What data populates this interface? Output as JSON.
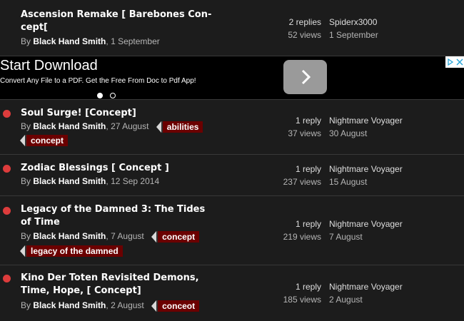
{
  "threads": [
    {
      "title": "Ascension Remake [ Barebones Con- cept[",
      "by": "By",
      "author": "Black Hand Smith",
      "date": "1 September",
      "tags": [],
      "replies": "2 replies",
      "views": "52 views",
      "last_user": "Spiderx3000",
      "last_date": "1 September",
      "unread": false
    },
    {
      "title": "Soul Surge! [Concept]",
      "by": "By",
      "author": "Black Hand Smith",
      "date": "27 August",
      "tags": [
        "abilities",
        "concept"
      ],
      "replies": "1 reply",
      "views": "37 views",
      "last_user": "Nightmare Voyager",
      "last_date": "30 August",
      "unread": true
    },
    {
      "title": "Zodiac Blessings [ Concept ]",
      "by": "By",
      "author": "Black Hand Smith",
      "date": "12 Sep 2014",
      "tags": [],
      "replies": "1 reply",
      "views": "237 views",
      "last_user": "Nightmare Voyager",
      "last_date": "15 August",
      "unread": true
    },
    {
      "title": "Legacy of the Damned 3: The Tides of Time",
      "by": "By",
      "author": "Black Hand Smith",
      "date": "7 August",
      "tags": [
        "concept",
        "legacy of the damned"
      ],
      "replies": "1 reply",
      "views": "219 views",
      "last_user": "Nightmare Voyager",
      "last_date": "7 August",
      "unread": true
    },
    {
      "title": "Kino Der Toten Revisited Demons, Time, Hope, [ Concept]",
      "by": "By",
      "author": "Black Hand Smith",
      "date": "2 August",
      "tags": [
        "conceot"
      ],
      "replies": "1 reply",
      "views": "185 views",
      "last_user": "Nightmare Voyager",
      "last_date": "2 August",
      "unread": true
    }
  ],
  "ad": {
    "title": "Start Download",
    "subtitle": "Convert Any File to a PDF. Get the Free From Doc to Pdf App!",
    "button_icon": "chevron-right-icon",
    "slides_total": 2,
    "slide_active": 1
  },
  "colors": {
    "background": "#1c1c1c",
    "unread_dot": "#dd3c3c",
    "tag_bg": "#6b0000",
    "ad_bg": "#000000",
    "ad_button": "#9a9a9a"
  }
}
